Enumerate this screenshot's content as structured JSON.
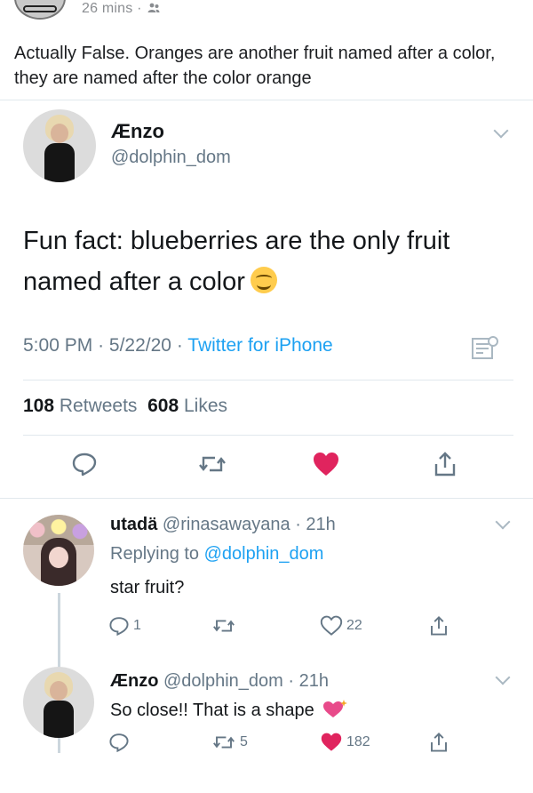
{
  "post": {
    "time": "26 mins",
    "separator": "·",
    "audience_icon": "people-icon",
    "caption": "Actually False. Oranges are another fruit named after a color, they are named after the color orange"
  },
  "tweet": {
    "name": "Ænzo",
    "handle": "@dolphin_dom",
    "text": "Fun fact: blueberries are the only fruit named after a color",
    "emoji": "smiling-face-icon",
    "time": "5:00 PM",
    "date": "5/22/20",
    "sep1": "·",
    "sep2": "·",
    "source": "Twitter for iPhone",
    "retweets_count": "108",
    "retweets_label": "Retweets",
    "likes_count": "608",
    "likes_label": "Likes",
    "colors": {
      "link": "#1da1f2",
      "like": "#e0245e",
      "muted": "#657786"
    }
  },
  "reply1": {
    "name": "utadä",
    "handle": "@rinasawayana",
    "sep": "·",
    "time": "21h",
    "replying_label": "Replying to",
    "replying_to": "@dolphin_dom",
    "text": "star fruit?",
    "reply_count": "1",
    "like_count": "22"
  },
  "reply2": {
    "name": "Ænzo",
    "handle": "@dolphin_dom",
    "sep": "·",
    "time": "21h",
    "text": "So close!! That is a shape",
    "emoji": "sparkling-heart-icon",
    "retweet_count": "5",
    "like_count": "182"
  }
}
